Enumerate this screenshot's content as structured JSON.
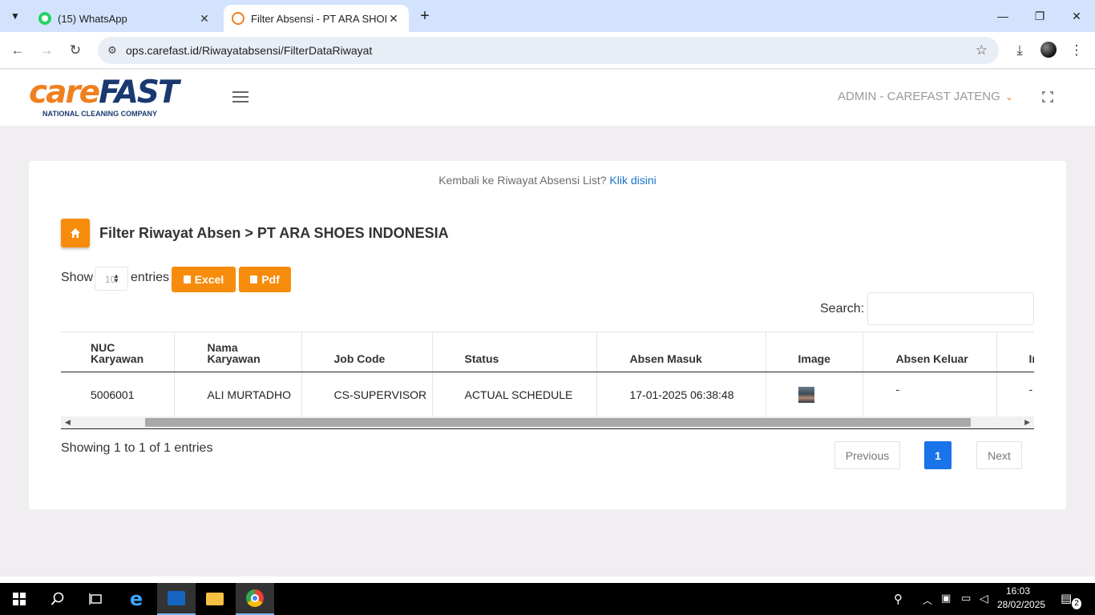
{
  "browser": {
    "tabs": [
      {
        "title": "(15) WhatsApp",
        "active": false
      },
      {
        "title": "Filter Absensi - PT ARA SHOES I",
        "active": true
      }
    ],
    "url": "ops.carefast.id/Riwayatabsensi/FilterDataRiwayat"
  },
  "header": {
    "logo_care": "care",
    "logo_fast": "FAST",
    "logo_tagline": "NATIONAL CLEANING COMPANY",
    "user_menu": "ADMIN - CAREFAST JATENG"
  },
  "page": {
    "back_text": "Kembali ke Riwayat Absensi List?",
    "back_link": "Klik disini",
    "title": "Filter Riwayat Absen > PT ARA SHOES INDONESIA",
    "show_label": "Show",
    "page_length": "10",
    "entries_label": "entries",
    "excel_label": "Excel",
    "pdf_label": "Pdf",
    "search_label": "Search:",
    "search_value": ""
  },
  "table": {
    "headers": [
      "NUC\nKaryawan",
      "Nama\nKaryawan",
      "Job Code",
      "Status",
      "Absen Masuk",
      "Image",
      "Absen Keluar",
      "In"
    ],
    "rows": [
      {
        "nuc": "5006001",
        "nama": "ALI MURTADHO",
        "job": "CS-SUPERVISOR",
        "status": "ACTUAL SCHEDULE",
        "absen_masuk": "17-01-2025 06:38:48",
        "absen_keluar": "-",
        "extra": "-"
      }
    ]
  },
  "footer": {
    "info": "Showing 1 to 1 of 1 entries",
    "prev": "Previous",
    "current_page": "1",
    "next": "Next"
  },
  "taskbar": {
    "time": "16:03",
    "date": "28/02/2025",
    "notifications": "2"
  },
  "colors": {
    "brand_orange": "#f78c0c",
    "brand_navy": "#1a3970",
    "link_blue": "#1a73c8",
    "page_active": "#1a73e8"
  }
}
